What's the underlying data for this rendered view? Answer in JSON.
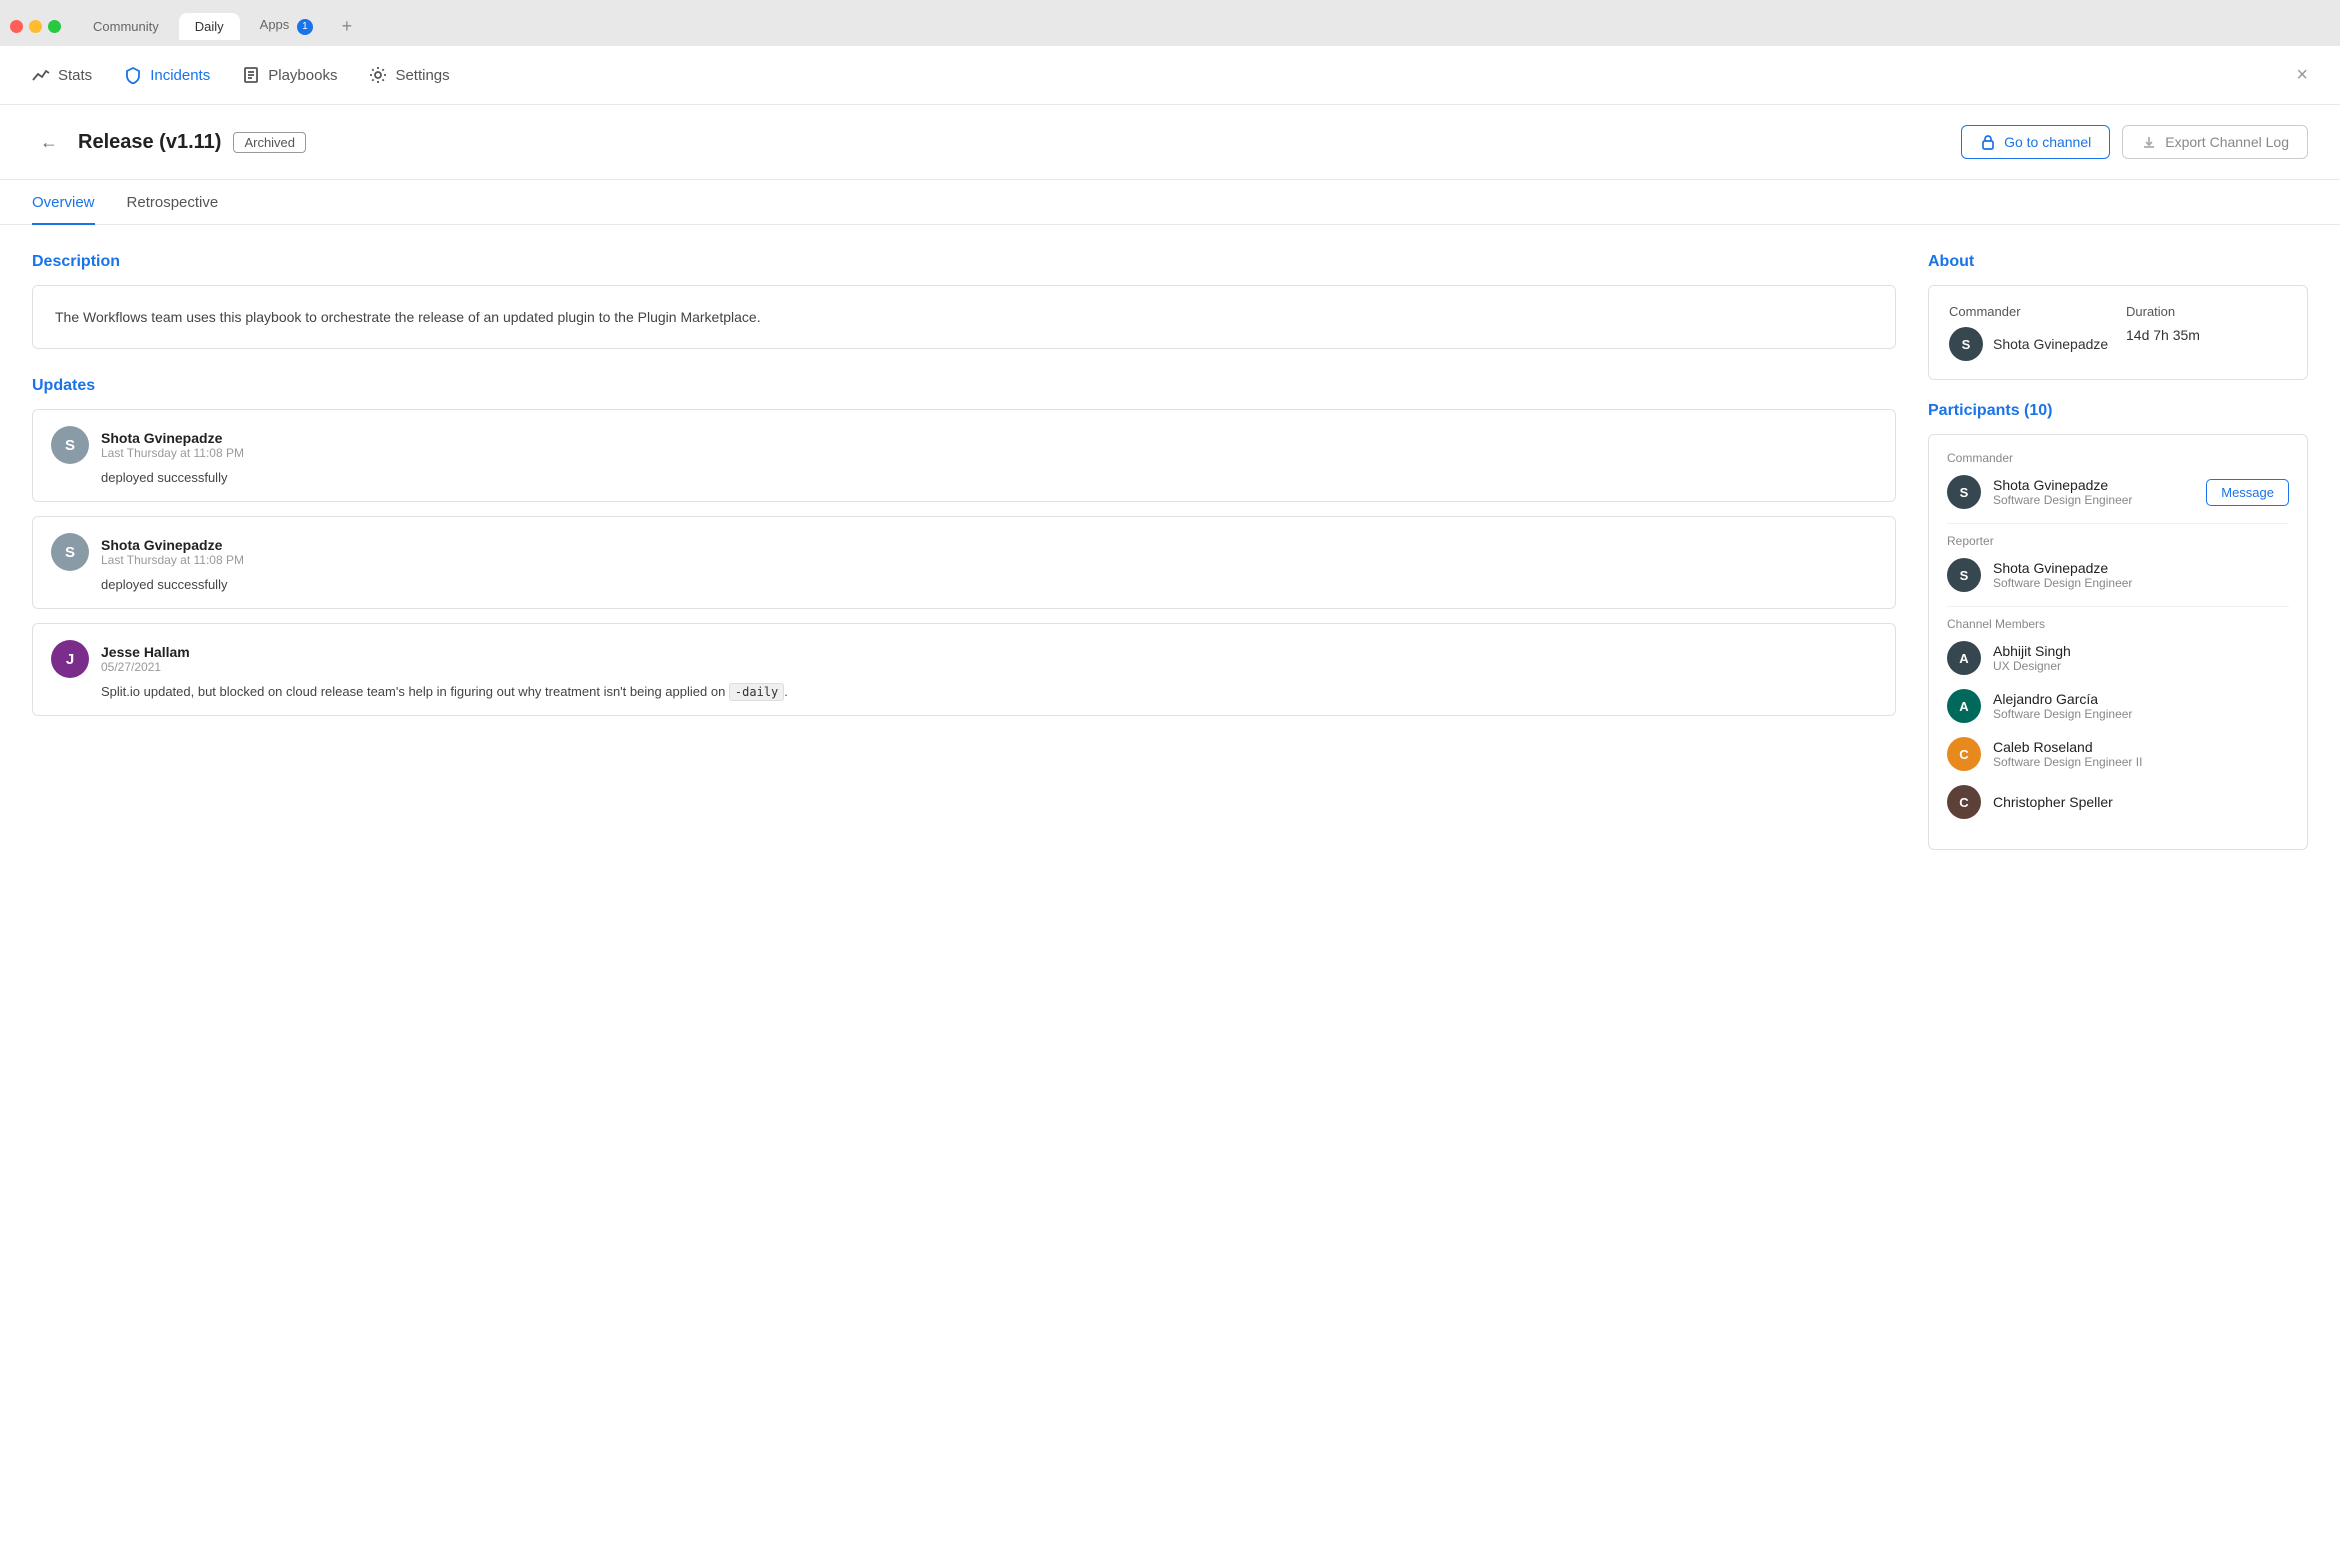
{
  "tabBar": {
    "tabs": [
      {
        "id": "community",
        "label": "Community",
        "active": false,
        "badge": null
      },
      {
        "id": "daily",
        "label": "Daily",
        "active": true,
        "badge": null
      },
      {
        "id": "apps",
        "label": "Apps",
        "active": false,
        "badge": "1"
      }
    ],
    "addLabel": "+"
  },
  "nav": {
    "items": [
      {
        "id": "stats",
        "label": "Stats",
        "icon": "chart-icon",
        "active": false
      },
      {
        "id": "incidents",
        "label": "Incidents",
        "icon": "shield-icon",
        "active": true
      },
      {
        "id": "playbooks",
        "label": "Playbooks",
        "icon": "book-icon",
        "active": false
      },
      {
        "id": "settings",
        "label": "Settings",
        "icon": "gear-icon",
        "active": false
      }
    ],
    "closeLabel": "×"
  },
  "incident": {
    "backLabel": "←",
    "title": "Release (v1.11)",
    "archivedLabel": "Archived",
    "actions": {
      "goToChannel": "Go to channel",
      "exportChannelLog": "Export Channel Log"
    }
  },
  "tabs": [
    {
      "id": "overview",
      "label": "Overview",
      "active": true
    },
    {
      "id": "retrospective",
      "label": "Retrospective",
      "active": false
    }
  ],
  "description": {
    "sectionTitle": "Description",
    "text": "The Workflows team uses this playbook to orchestrate the release of an updated plugin to the Plugin Marketplace."
  },
  "updates": {
    "sectionTitle": "Updates",
    "items": [
      {
        "id": "u1",
        "name": "Shota Gvinepadze",
        "time": "Last Thursday at 11:08 PM",
        "body": "deployed successfully",
        "avatarColor": "gray",
        "avatarInitial": "S"
      },
      {
        "id": "u2",
        "name": "Shota Gvinepadze",
        "time": "Last Thursday at 11:08 PM",
        "body": "deployed successfully",
        "avatarColor": "gray",
        "avatarInitial": "S"
      },
      {
        "id": "u3",
        "name": "Jesse Hallam",
        "time": "05/27/2021",
        "bodyParts": [
          "Split.io updated, but blocked on cloud release team's help in figuring out why treatment isn't being applied on ",
          "-daily",
          "."
        ],
        "avatarColor": "purple",
        "avatarInitial": "J"
      }
    ]
  },
  "about": {
    "sectionTitle": "About",
    "commanderLabel": "Commander",
    "commanderName": "Shota Gvinepadze",
    "durationLabel": "Duration",
    "durationValue": "14d 7h 35m"
  },
  "participants": {
    "sectionTitle": "Participants (10)",
    "commanderLabel": "Commander",
    "reporterLabel": "Reporter",
    "channelMembersLabel": "Channel Members",
    "commander": {
      "name": "Shota Gvinepadze",
      "role": "Software Design Engineer",
      "avatarColor": "dark",
      "avatarInitial": "S",
      "messageLabel": "Message"
    },
    "reporter": {
      "name": "Shota Gvinepadze",
      "role": "Software Design Engineer",
      "avatarColor": "dark",
      "avatarInitial": "S"
    },
    "channelMembers": [
      {
        "name": "Abhijit Singh",
        "role": "UX Designer",
        "avatarColor": "dark",
        "avatarInitial": "A"
      },
      {
        "name": "Alejandro García",
        "role": "Software Design Engineer",
        "avatarColor": "teal",
        "avatarInitial": "A"
      },
      {
        "name": "Caleb Roseland",
        "role": "Software Design Engineer II",
        "avatarColor": "orange",
        "avatarInitial": "C"
      },
      {
        "name": "Christopher Speller",
        "role": "",
        "avatarColor": "brown",
        "avatarInitial": "C"
      }
    ]
  }
}
